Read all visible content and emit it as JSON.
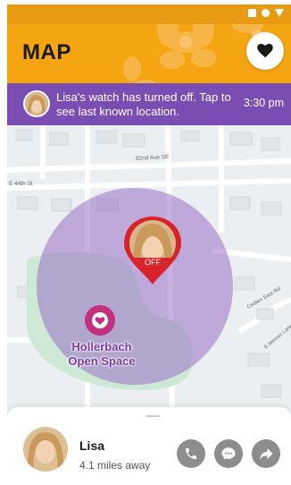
{
  "status_bar": {
    "icons": [
      "square-icon",
      "circle-icon",
      "triangle-icon"
    ]
  },
  "header": {
    "title": "MAP",
    "right_icon": "heart-icon"
  },
  "notification": {
    "message": "Lisa's watch has turned off. Tap to see last known location.",
    "time": "3:30 pm"
  },
  "map": {
    "street_labels": [
      "92nd Ave SE",
      "E 44th St",
      "Cedars East Rd",
      "E Mercer Lane"
    ],
    "marker_status": "OFF",
    "poi_name_line1": "Hollerbach",
    "poi_name_line2": "Open Space"
  },
  "person": {
    "name": "Lisa",
    "distance": "4.1 miles away"
  },
  "actions": [
    "phone-icon",
    "message-icon",
    "directions-icon"
  ],
  "colors": {
    "header": "#f5a412",
    "status_bar": "#e89a12",
    "notification": "#7a4db3",
    "geofence": "#9b6fc6",
    "marker": "#d8232a",
    "poi": "#c4307e"
  }
}
